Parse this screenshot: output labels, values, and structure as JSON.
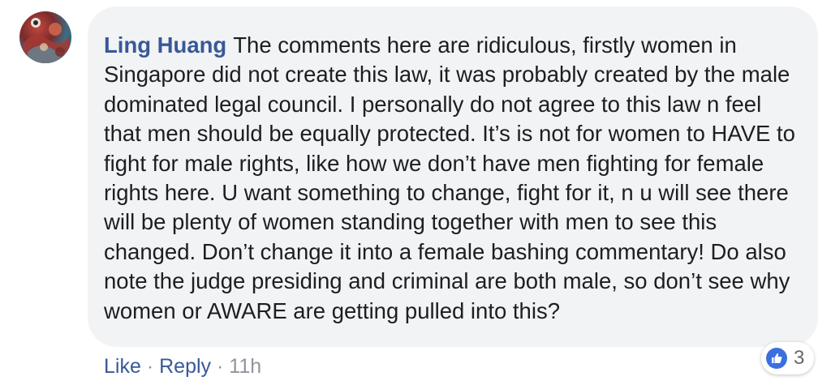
{
  "comment": {
    "author": "Ling Huang",
    "text": "The comments here are ridiculous, firstly women in Singapore did not create this law, it was probably created by the male dominated legal council. I personally do not agree to this law n feel that men should be equally protected. It’s is not for women to HAVE to fight for male rights, like how we don’t have men fighting for female rights here. U want something to change, fight for it, n u will see there will be plenty of women standing together with men to see this changed. Don’t change it into a female bashing commentary! Do also note the judge presiding and criminal are both male, so don’t see why women or AWARE are getting pulled into this?",
    "actions": {
      "like_label": "Like",
      "reply_label": "Reply",
      "separator": "·",
      "timestamp": "11h"
    },
    "reactions": {
      "icon": "thumbs-up-icon",
      "count": "3",
      "color": "#3b6fe0"
    }
  }
}
